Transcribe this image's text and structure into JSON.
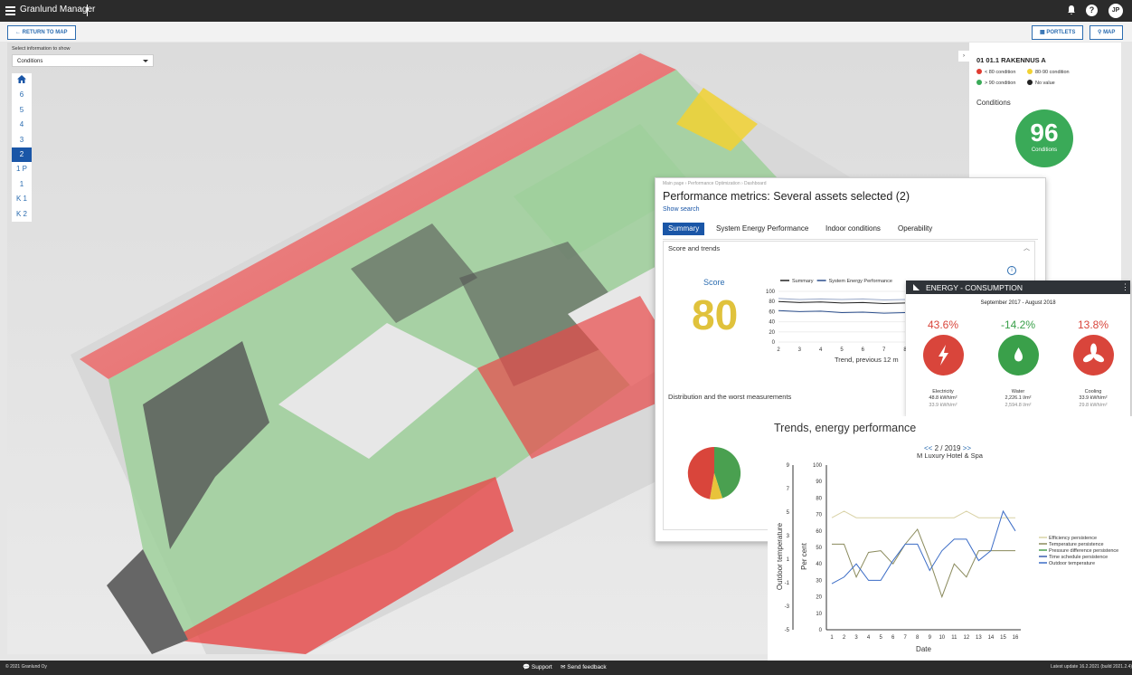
{
  "app": {
    "title": "Granlund Manager",
    "user_initials": "JP"
  },
  "toolbar": {
    "return_label": "RETURN TO MAP",
    "portlets_label": "PORTLETS",
    "map_label": "MAP"
  },
  "left_panel": {
    "select_label": "Select information to show",
    "select_value": "Conditions",
    "floors": [
      "6",
      "5",
      "4",
      "3",
      "2",
      "1 P",
      "1",
      "K 1",
      "K 2"
    ],
    "active_floor": "2"
  },
  "right_panel": {
    "building": "01 01.1 RAKENNUS A",
    "legend": [
      {
        "label": "< 80 condition",
        "color": "#e03c31"
      },
      {
        "label": "80-90 condition",
        "color": "#f2d233"
      },
      {
        "label": "> 90 condition",
        "color": "#3aaa58"
      },
      {
        "label": "No value",
        "color": "#222222"
      }
    ],
    "conditions_label": "Conditions",
    "conditions_value": "96",
    "conditions_unit": "Conditions"
  },
  "performance": {
    "breadcrumb": "Main page › Performance Optimization › Dashboard",
    "title": "Performance metrics: Several assets selected (2)",
    "show_search": "Show search",
    "tabs": [
      "Summary",
      "System Energy Performance",
      "Indoor conditions",
      "Operability"
    ],
    "active_tab": "Summary",
    "section_score": "Score and trends",
    "score_label": "Score",
    "score_value": "80",
    "section_distribution": "Distribution and the worst measurements",
    "trend_caption": "Trend, previous 12 m",
    "pie_colors": [
      "#d9453b",
      "#4aa050",
      "#e8c33a"
    ]
  },
  "energy": {
    "title": "ENERGY - CONSUMPTION",
    "period": "September 2017 - August 2018",
    "items": [
      {
        "pct": "43.6%",
        "name": "Electricity",
        "current": "48.8 kWh/m²",
        "previous": "33.9 kWh/m²",
        "color": "#d9453b",
        "icon": "lightning-icon"
      },
      {
        "pct": "-14.2%",
        "name": "Water",
        "current": "2,226.1 l/m²",
        "previous": "2,594.8 l/m²",
        "color": "#3aa04a",
        "icon": "water-drop-icon"
      },
      {
        "pct": "13.8%",
        "name": "Cooling",
        "current": "33.9 kWh/m²",
        "previous": "29.8 kWh/m²",
        "color": "#d9453b",
        "icon": "fan-icon"
      }
    ]
  },
  "trends": {
    "title": "Trends, energy performance",
    "nav_prev": "<<",
    "nav_label": "2 / 2019",
    "nav_next": ">>",
    "subtitle": "M Luxury Hotel & Spa"
  },
  "chart_data": [
    {
      "type": "line",
      "title": "",
      "xlabel": "Trend, previous 12 m",
      "x": [
        2,
        3,
        4,
        5,
        6,
        7,
        8
      ],
      "ylim": [
        0,
        100
      ],
      "yticks": [
        0,
        20,
        40,
        60,
        80,
        100
      ],
      "series": [
        {
          "name": "Summary",
          "color": "#222222",
          "values": [
            80,
            78,
            79,
            77,
            78,
            76,
            77
          ]
        },
        {
          "name": "System Energy Performance",
          "color": "#2b4e8c",
          "values": [
            62,
            60,
            61,
            58,
            59,
            57,
            58
          ]
        },
        {
          "name": "",
          "color": "#9aa9c8",
          "values": [
            86,
            84,
            85,
            84,
            85,
            83,
            84
          ]
        }
      ],
      "legend": "top"
    },
    {
      "type": "line",
      "title": "Trends, energy performance",
      "xlabel": "Date",
      "ylabel": "Per cent",
      "y2label": "Outdoor temperature",
      "x": [
        1,
        2,
        3,
        4,
        5,
        6,
        7,
        8,
        9,
        10,
        11,
        12,
        13,
        14,
        15,
        16
      ],
      "ylim": [
        0,
        100
      ],
      "yticks": [
        0,
        10,
        20,
        30,
        40,
        50,
        60,
        70,
        80,
        90,
        100
      ],
      "y2lim": [
        -5,
        9
      ],
      "y2ticks": [
        -5,
        -3,
        -1,
        1,
        3,
        5,
        7,
        9
      ],
      "series": [
        {
          "name": "Efficiency persistence",
          "color": "#d9d2a6",
          "values": [
            68,
            72,
            68,
            68,
            68,
            68,
            68,
            68,
            68,
            68,
            68,
            72,
            68,
            68,
            68,
            68
          ]
        },
        {
          "name": "Temperature persistence",
          "color": "#8a8a5c",
          "values": [
            52,
            52,
            32,
            47,
            48,
            40,
            52,
            61,
            42,
            20,
            40,
            32,
            48,
            48,
            48,
            48
          ]
        },
        {
          "name": "Pressure difference persistence",
          "color": "#4aa050",
          "values": []
        },
        {
          "name": "Time schedule persistence",
          "color": "#3b5fb0",
          "values": []
        },
        {
          "name": "Outdoor temperature",
          "color": "#3b6cc6",
          "values": [
            28,
            32,
            40,
            30,
            30,
            42,
            52,
            52,
            36,
            48,
            55,
            55,
            42,
            48,
            72,
            60
          ]
        }
      ],
      "legend": "right"
    }
  ]
}
